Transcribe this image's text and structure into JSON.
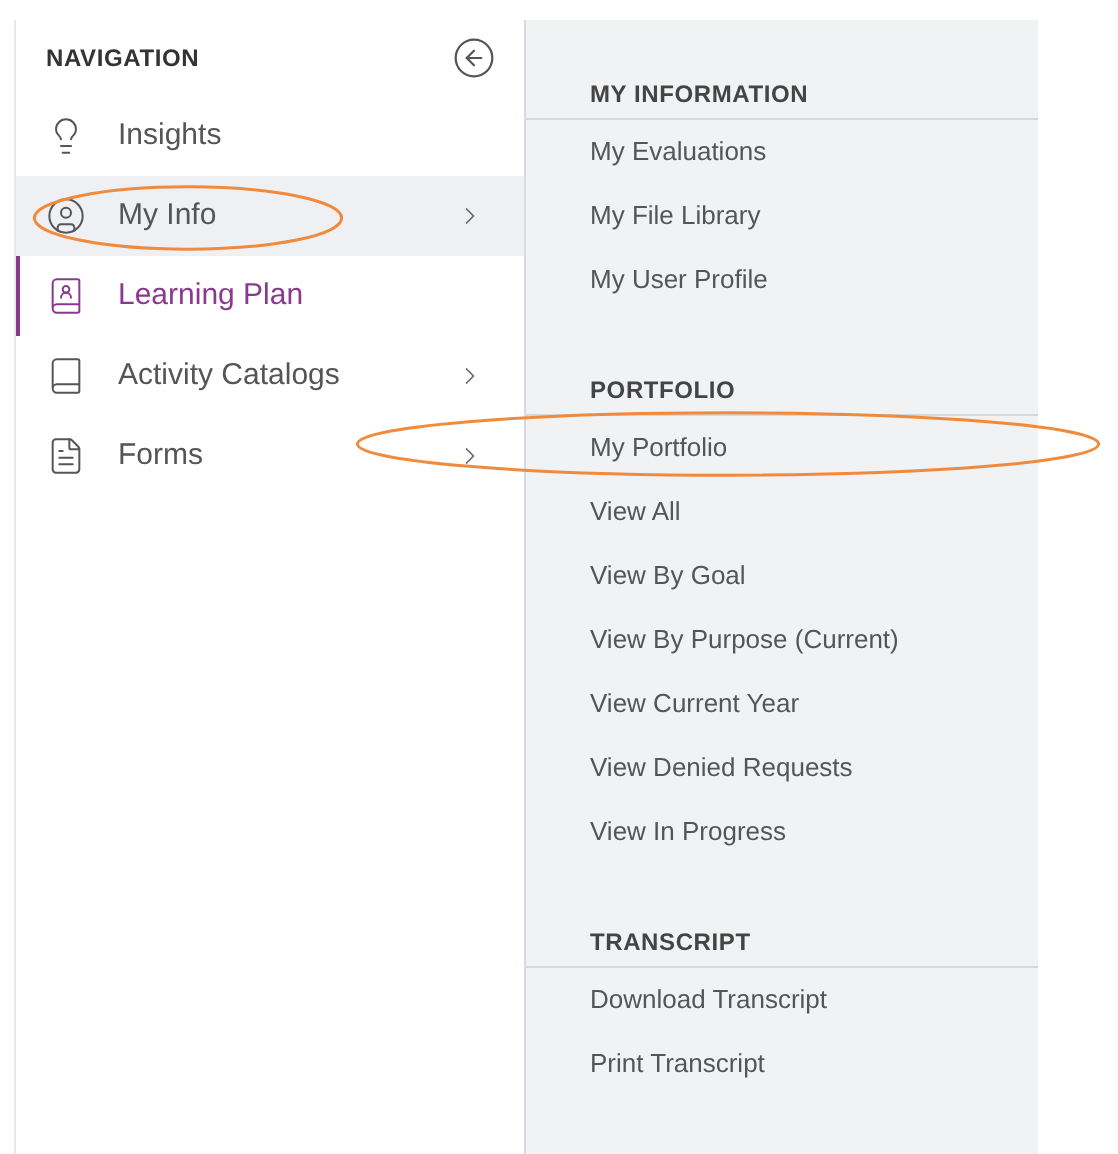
{
  "navigation": {
    "title": "NAVIGATION",
    "items": [
      {
        "label": "Insights",
        "kind": "bulb",
        "has_submenu": false,
        "expanded": false,
        "selected": false,
        "circled": false
      },
      {
        "label": "My Info",
        "kind": "user",
        "has_submenu": true,
        "expanded": true,
        "selected": false,
        "circled": true
      },
      {
        "label": "Learning Plan",
        "kind": "plan",
        "has_submenu": false,
        "expanded": false,
        "selected": true,
        "circled": false
      },
      {
        "label": "Activity Catalogs",
        "kind": "book",
        "has_submenu": true,
        "expanded": false,
        "selected": false,
        "circled": false
      },
      {
        "label": "Forms",
        "kind": "form",
        "has_submenu": true,
        "expanded": false,
        "selected": false,
        "circled": false
      }
    ]
  },
  "submenu": {
    "sections": [
      {
        "title": "MY INFORMATION",
        "items": [
          {
            "label": "My Evaluations",
            "circled": false
          },
          {
            "label": "My File Library",
            "circled": false
          },
          {
            "label": "My User Profile",
            "circled": false
          }
        ]
      },
      {
        "title": "PORTFOLIO",
        "items": [
          {
            "label": "My Portfolio",
            "circled": true
          },
          {
            "label": "View All",
            "circled": false
          },
          {
            "label": "View By Goal",
            "circled": false
          },
          {
            "label": "View By Purpose (Current)",
            "circled": false
          },
          {
            "label": "View Current Year",
            "circled": false
          },
          {
            "label": "View Denied Requests",
            "circled": false
          },
          {
            "label": "View In Progress",
            "circled": false
          }
        ]
      },
      {
        "title": "TRANSCRIPT",
        "items": [
          {
            "label": "Download Transcript",
            "circled": false
          },
          {
            "label": "Print Transcript",
            "circled": false
          }
        ]
      }
    ]
  }
}
